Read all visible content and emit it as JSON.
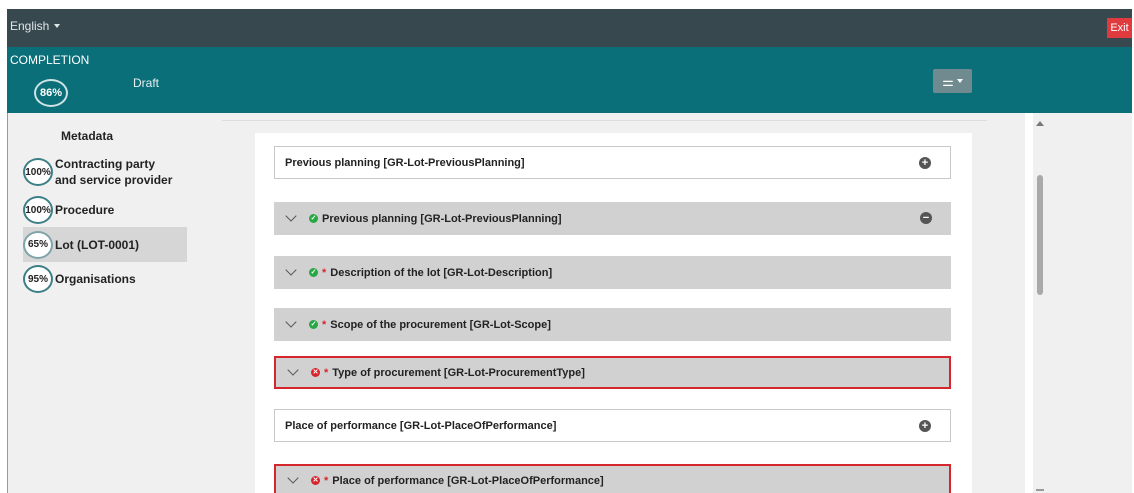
{
  "topbar": {
    "language": "English",
    "exit_label": "Exit",
    "color": "#37494f",
    "exit_color": "#e03a3e"
  },
  "completion": {
    "title": "COMPLETION",
    "percent": "86%",
    "status": "Draft",
    "color": "#0a6f79",
    "filter_icon": "sliders-icon"
  },
  "sidebar": {
    "title": "Metadata",
    "items": [
      {
        "percent": "100%",
        "label": "Contracting party and service provider",
        "active": false
      },
      {
        "percent": "100%",
        "label": "Procedure",
        "active": false
      },
      {
        "percent": "65%",
        "label": "Lot (LOT-0001)",
        "active": true
      },
      {
        "percent": "95%",
        "label": "Organisations",
        "active": false
      }
    ]
  },
  "sections": [
    {
      "type": "plain",
      "label": "Previous planning  [GR-Lot-PreviousPlanning]",
      "action": "add"
    },
    {
      "type": "section",
      "status": "ok",
      "required": false,
      "label": "Previous planning  [GR-Lot-PreviousPlanning]",
      "action": "remove"
    },
    {
      "type": "section",
      "status": "ok",
      "required": true,
      "label": "Description of the lot  [GR-Lot-Description]"
    },
    {
      "type": "section",
      "status": "ok",
      "required": true,
      "label": "Scope of the procurement  [GR-Lot-Scope]"
    },
    {
      "type": "section",
      "status": "error",
      "required": true,
      "label": "Type of procurement  [GR-Lot-ProcurementType]"
    },
    {
      "type": "plain",
      "label": "Place of performance  [GR-Lot-PlaceOfPerformance]",
      "action": "add"
    },
    {
      "type": "section",
      "status": "error",
      "required": true,
      "label": "Place of performance  [GR-Lot-PlaceOfPerformance]"
    }
  ],
  "symbols": {
    "required": "*",
    "plus": "+",
    "minus": "−",
    "ok": "✓",
    "error": "✕"
  }
}
